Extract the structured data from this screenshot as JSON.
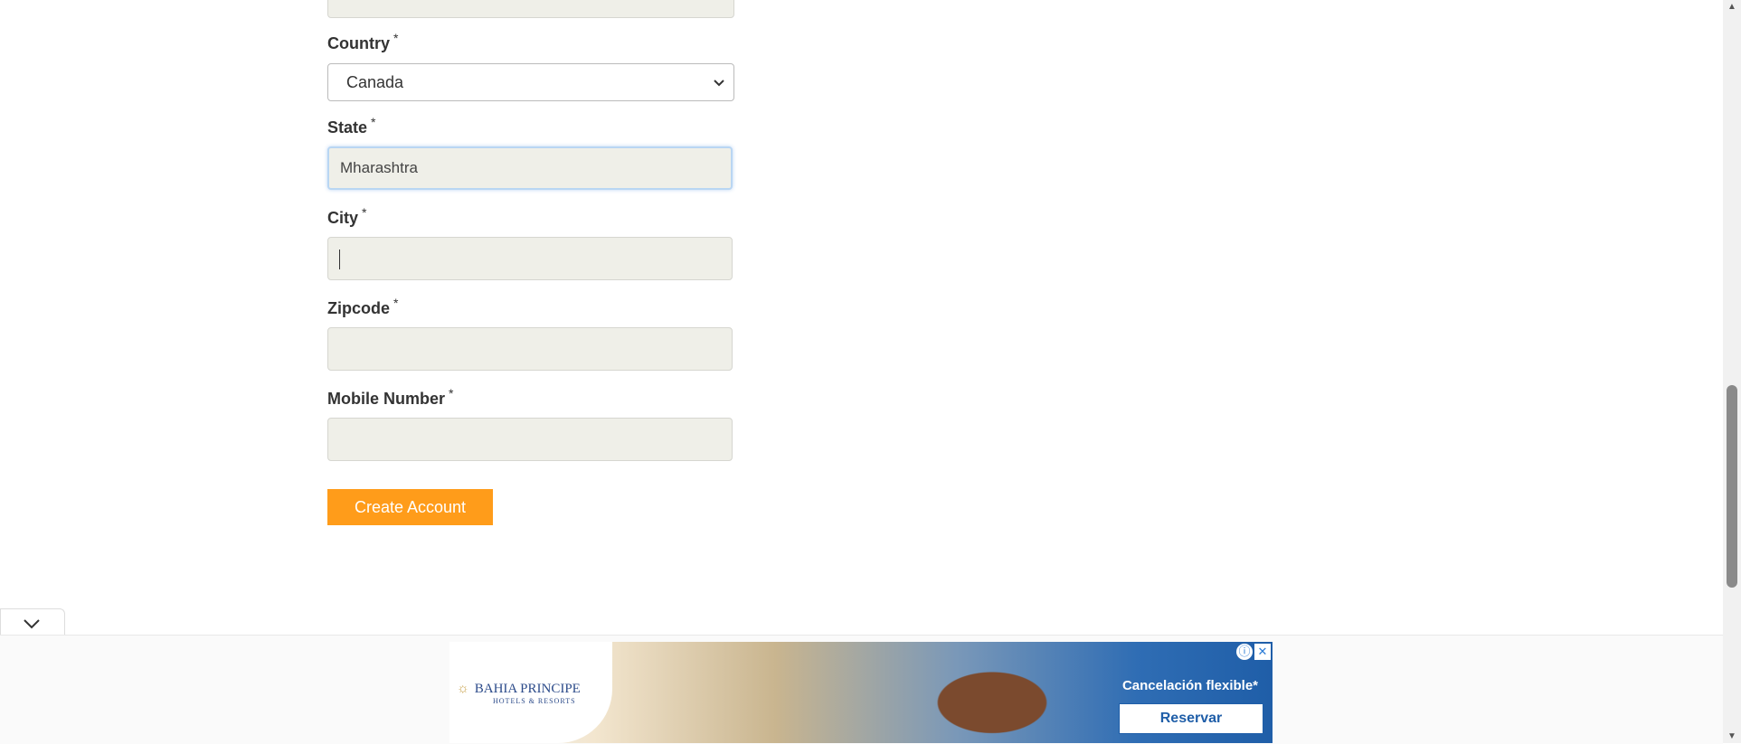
{
  "form": {
    "country": {
      "label": "Country",
      "required": "*",
      "selected": "Canada"
    },
    "state": {
      "label": "State",
      "required": "*",
      "value": "Mharashtra"
    },
    "city": {
      "label": "City",
      "required": "*",
      "value": ""
    },
    "zipcode": {
      "label": "Zipcode",
      "required": "*",
      "value": ""
    },
    "mobile": {
      "label": "Mobile Number",
      "required": "*",
      "value": ""
    },
    "submit_label": "Create Account"
  },
  "ad": {
    "brand": "BAHIA PRINCIPE",
    "brand_sub": "HOTELS & RESORTS",
    "tagline": "Cancelación flexible*",
    "cta": "Reservar",
    "info_icon": "info-icon",
    "close_icon": "close-icon"
  },
  "colors": {
    "button": "#ff9c1a",
    "input_bg": "#efefe8",
    "ad_blue": "#1f5ea8"
  }
}
